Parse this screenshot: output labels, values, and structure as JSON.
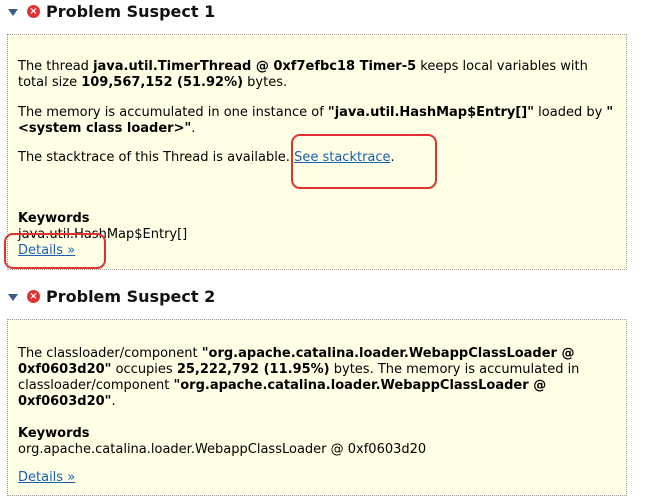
{
  "suspect1": {
    "title": "Problem Suspect 1",
    "line1_a": "The thread ",
    "line1_b": "java.util.TimerThread @ 0xf7efbc18 Timer-5",
    "line1_c": " keeps local variables with total size ",
    "line1_d": "109,567,152 (51.92%)",
    "line1_e": " bytes.",
    "line2_a": "The memory is accumulated in one instance of ",
    "line2_b": "\"java.util.HashMap$Entry[]\"",
    "line2_c": " loaded by ",
    "line2_d": "\"<system class loader>\"",
    "line2_e": ".",
    "line3_a": "The stacktrace of this Thread is available. ",
    "line3_link": "See stacktrace",
    "line3_b": ".",
    "keywords_label": "Keywords",
    "keywords_value": "java.util.HashMap$Entry[]",
    "details_link": "Details »"
  },
  "suspect2": {
    "title": "Problem Suspect 2",
    "text_a": "The classloader/component ",
    "text_b": "\"org.apache.catalina.loader.WebappClassLoader @ 0xf0603d20\"",
    "text_c": " occupies ",
    "text_d": "25,222,792 (11.95%)",
    "text_e": " bytes. The memory is accumulated in classloader/component ",
    "text_f": "\"org.apache.catalina.loader.WebappClassLoader @ 0xf0603d20\"",
    "text_g": ".",
    "keywords_label": "Keywords",
    "keywords_value": "org.apache.catalina.loader.WebappClassLoader @ 0xf0603d20",
    "details_link": "Details »"
  },
  "icons": {
    "expand": "triangle-down",
    "error": "error-circle-x"
  },
  "colors": {
    "panel_bg": "#ffffe5",
    "link": "#1a5fb4",
    "highlight": "#e03030"
  }
}
